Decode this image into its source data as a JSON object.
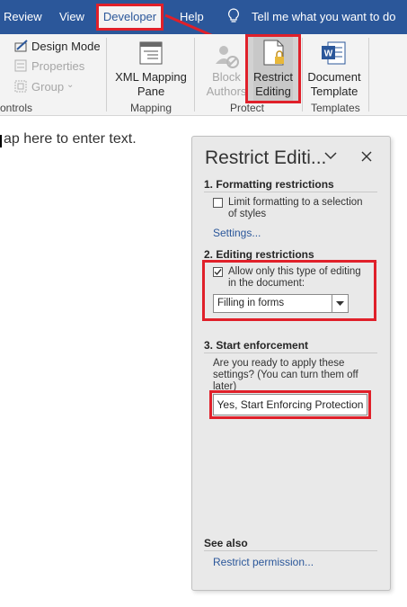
{
  "tabs": {
    "review": "Review",
    "view": "View",
    "developer": "Developer",
    "help": "Help",
    "tell_me": "Tell me what you want to do"
  },
  "ribbon": {
    "controls_group": {
      "design_mode": "Design Mode",
      "properties": "Properties",
      "group": "Group",
      "label": "ontrols"
    },
    "mapping_group": {
      "xml_line1": "XML Mapping",
      "xml_line2": "Pane",
      "label": "Mapping"
    },
    "protect_group": {
      "block_line1": "Block",
      "block_line2": "Authors",
      "restrict_line1": "Restrict",
      "restrict_line2": "Editing",
      "label": "Protect"
    },
    "templates_group": {
      "doc_line1": "Document",
      "doc_line2": "Template",
      "label": "Templates"
    }
  },
  "document": {
    "placeholder": "ap here to enter text."
  },
  "pane": {
    "title": "Restrict Editi...",
    "section1": {
      "title": "1. Formatting restrictions",
      "checkbox_line1": "Limit formatting to a selection",
      "checkbox_line2": "of styles",
      "settings_link": "Settings..."
    },
    "section2": {
      "title": "2. Editing restrictions",
      "checkbox_line1": "Allow only this type of editing",
      "checkbox_line2": "in the document:",
      "select_value": "Filling in forms"
    },
    "section3": {
      "title": "3. Start enforcement",
      "desc_line1": "Are you ready to apply these",
      "desc_line2": "settings? (You can turn them off",
      "desc_line3": "later)",
      "button": "Yes, Start Enforcing Protection"
    },
    "see_also": {
      "title": "See also",
      "link": "Restrict permission..."
    }
  },
  "colors": {
    "accent": "#2b579a",
    "highlight": "#e0202a",
    "pane_bg": "#e9e9e9"
  }
}
